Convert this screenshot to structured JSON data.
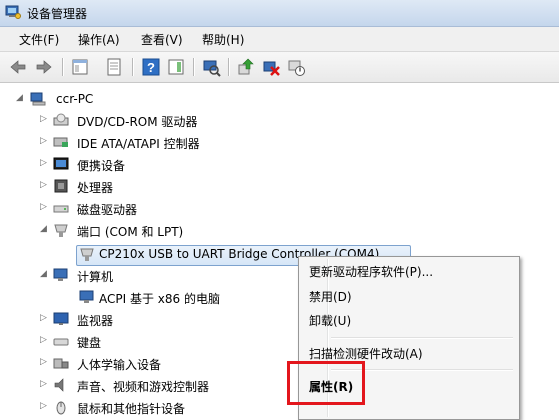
{
  "window": {
    "title": "设备管理器"
  },
  "menu": [
    "文件(F)",
    "操作(A)",
    "查看(V)",
    "帮助(H)"
  ],
  "toolbar_icons": [
    "back-icon",
    "forward-icon",
    "console-tree-icon",
    "properties-icon",
    "help-icon",
    "action-pane-icon",
    "scan-hardware-icon",
    "update-driver-icon",
    "uninstall-icon",
    "disable-icon"
  ],
  "tree": {
    "root": "ccr-PC",
    "items": [
      {
        "label": "DVD/CD-ROM 驱动器"
      },
      {
        "label": "IDE ATA/ATAPI 控制器"
      },
      {
        "label": "便携设备"
      },
      {
        "label": "处理器"
      },
      {
        "label": "磁盘驱动器"
      },
      {
        "label": "端口 (COM 和 LPT)"
      },
      {
        "label": "CP210x USB to UART Bridge Controller (COM4)"
      },
      {
        "label": "计算机"
      },
      {
        "label": "ACPI 基于 x86 的电脑"
      },
      {
        "label": "监视器"
      },
      {
        "label": "键盘"
      },
      {
        "label": "人体学输入设备"
      },
      {
        "label": "声音、视频和游戏控制器"
      },
      {
        "label": "鼠标和其他指针设备"
      }
    ]
  },
  "context_menu": {
    "items": [
      "更新驱动程序软件(P)...",
      "禁用(D)",
      "卸载(U)",
      "扫描检测硬件改动(A)",
      "属性(R)"
    ]
  },
  "colors": {
    "highlight": "#e3161c",
    "selection_border": "#7da2ce"
  }
}
